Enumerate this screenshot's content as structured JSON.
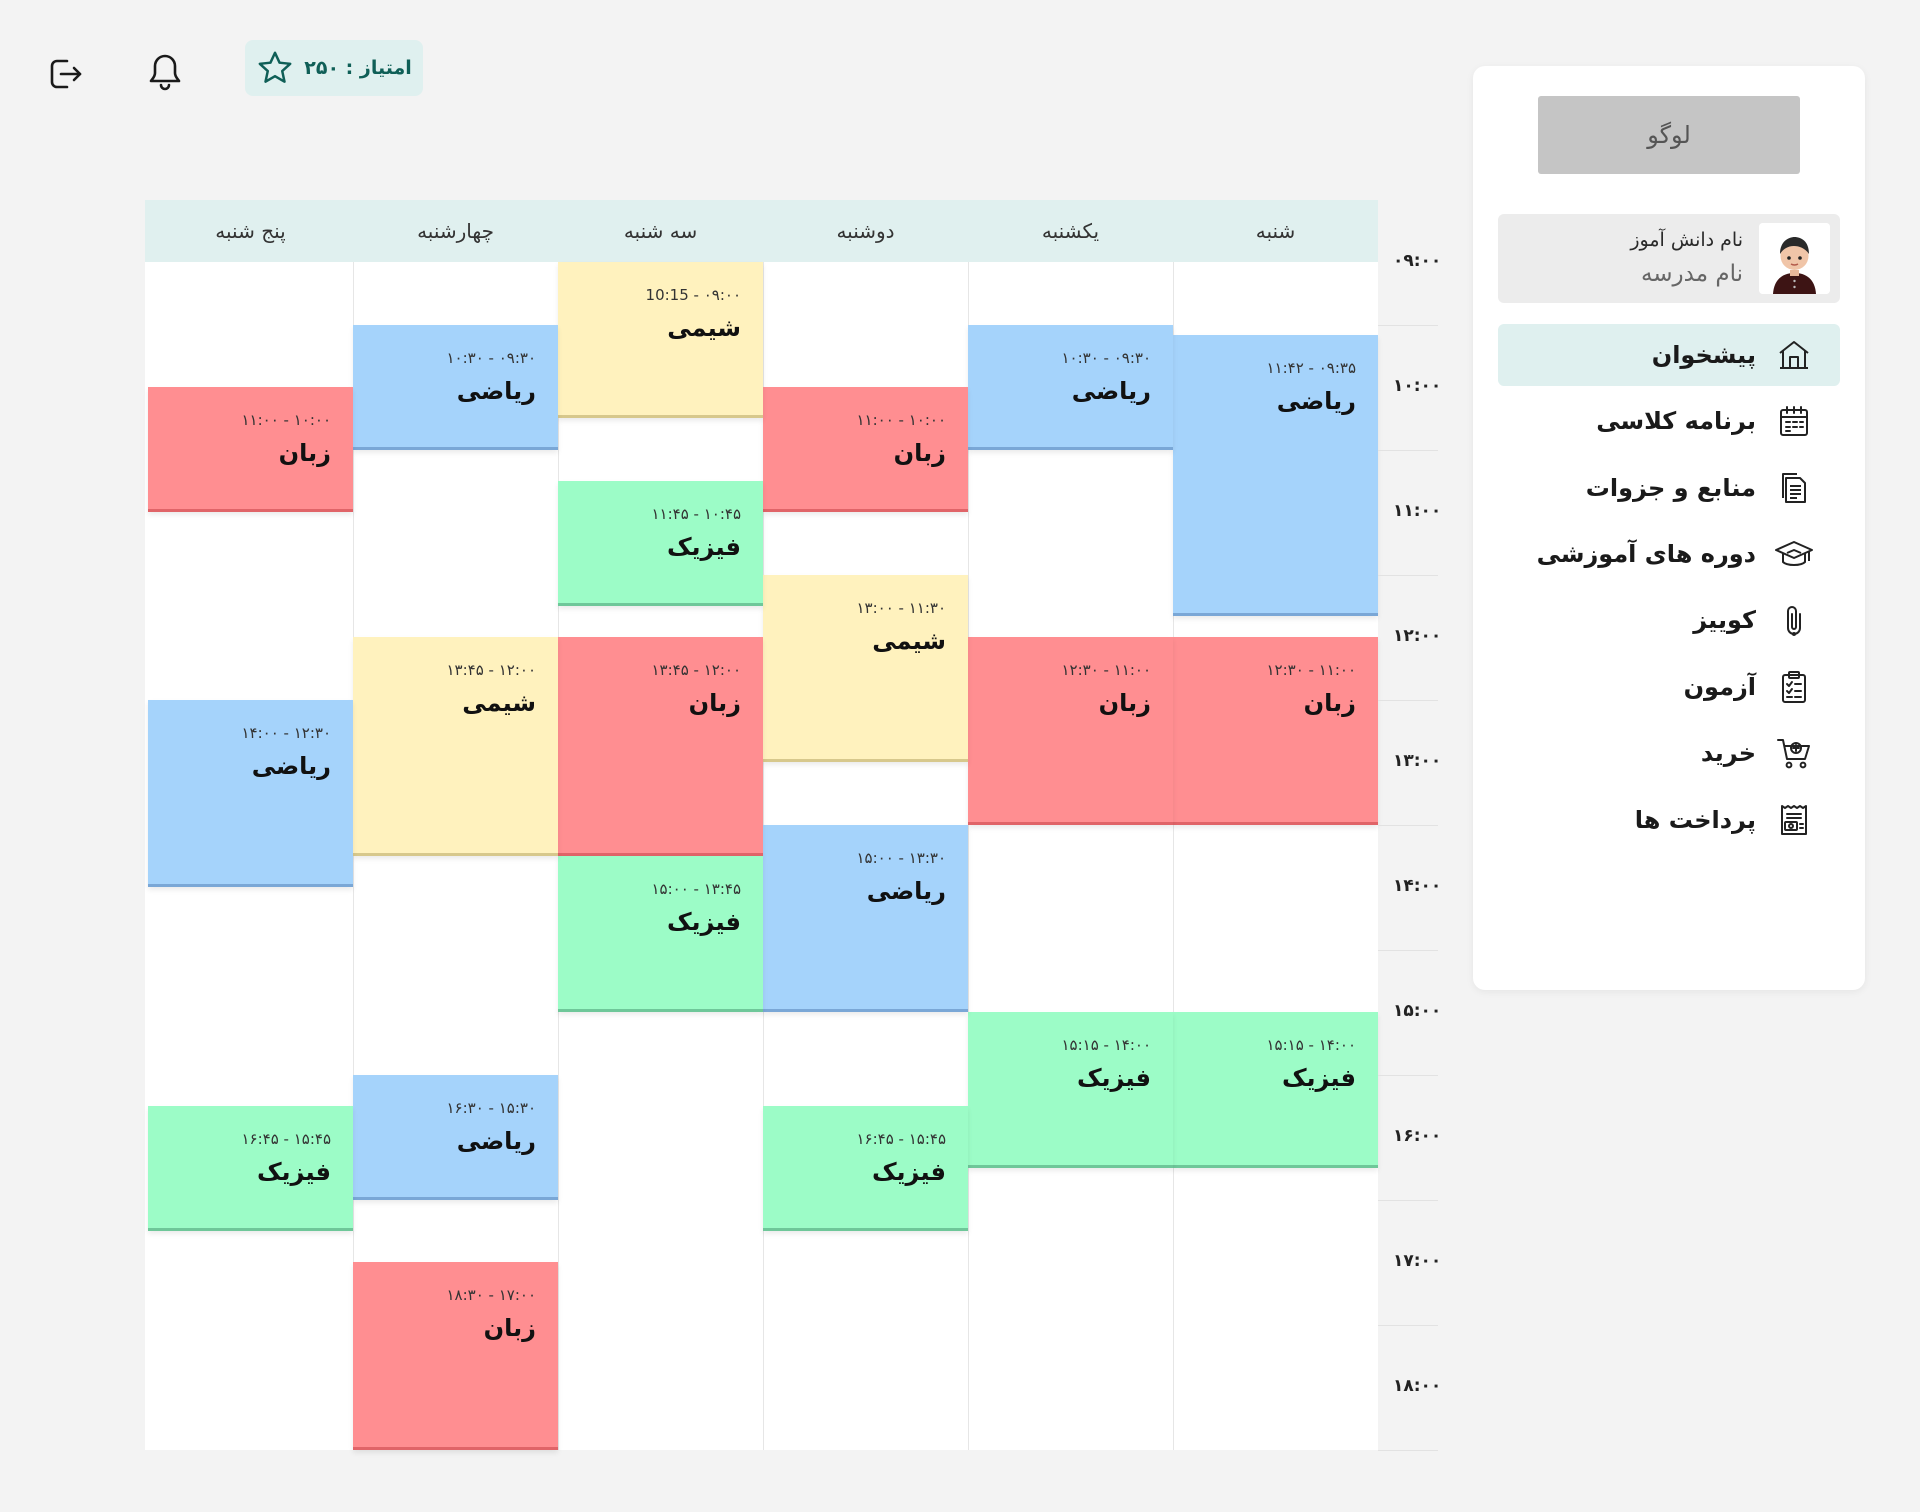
{
  "topbar": {
    "score_text": "امتیاز : ۲۵۰",
    "logout_icon": "logout-icon",
    "bell_icon": "bell-icon",
    "star_icon": "star-icon"
  },
  "sidebar": {
    "logo": "لوگو",
    "profile": {
      "student_name": "نام دانش آموز",
      "school_name": "نام مدرسه"
    },
    "items": [
      {
        "label": "پیشخوان",
        "icon": "home-icon",
        "active": true
      },
      {
        "label": "برنامه کلاسی",
        "icon": "calendar-icon",
        "active": false
      },
      {
        "label": "منابع و جزوات",
        "icon": "documents-icon",
        "active": false
      },
      {
        "label": "دوره های آموزشی",
        "icon": "graduation-cap-icon",
        "active": false
      },
      {
        "label": "کوییز",
        "icon": "paperclip-icon",
        "active": false
      },
      {
        "label": "آزمون",
        "icon": "clipboard-check-icon",
        "active": false
      },
      {
        "label": "خرید",
        "icon": "cart-icon",
        "active": false
      },
      {
        "label": "پرداخت ها",
        "icon": "receipt-icon",
        "active": false
      }
    ]
  },
  "schedule": {
    "days": [
      "شنبه",
      "یکشنبه",
      "دوشنبه",
      "سه شنبه",
      "چهارشنبه",
      "پنج شنبه"
    ],
    "times": [
      "۰۹:۰۰",
      "۱۰:۰۰",
      "۱۱:۰۰",
      "۱۲:۰۰",
      "۱۳:۰۰",
      "۱۴:۰۰",
      "۱۵:۰۰",
      "۱۶:۰۰",
      "۱۷:۰۰",
      "۱۸:۰۰"
    ],
    "colors": {
      "red": "#ff8e91",
      "blue": "#a5d3fb",
      "yellow": "#fff2be",
      "green": "#9cfcc7",
      "header": "#e0f0ef",
      "accent": "#0f5f57"
    },
    "classes": [
      {
        "day": 0,
        "name": "ریاضی",
        "time": "۰۹:۳۵ - ۱۱:۴۲",
        "start": 9.58,
        "end": 11.83,
        "color": "blue"
      },
      {
        "day": 0,
        "name": "زبان",
        "time": "۱۱:۰۰ - ۱۲:۳۰",
        "start": 12.0,
        "end": 13.5,
        "color": "red"
      },
      {
        "day": 0,
        "name": "فیزیک",
        "time": "۱۴:۰۰ - ۱۵:۱۵",
        "start": 15.0,
        "end": 16.25,
        "color": "green"
      },
      {
        "day": 1,
        "name": "ریاضی",
        "time": "۰۹:۳۰ - ۱۰:۳۰",
        "start": 9.5,
        "end": 10.5,
        "color": "blue"
      },
      {
        "day": 1,
        "name": "زبان",
        "time": "۱۱:۰۰ - ۱۲:۳۰",
        "start": 12.0,
        "end": 13.5,
        "color": "red"
      },
      {
        "day": 1,
        "name": "فیزیک",
        "time": "۱۴:۰۰ - ۱۵:۱۵",
        "start": 15.0,
        "end": 16.25,
        "color": "green"
      },
      {
        "day": 2,
        "name": "زبان",
        "time": "۱۰:۰۰ - ۱۱:۰۰",
        "start": 10.0,
        "end": 11.0,
        "color": "red"
      },
      {
        "day": 2,
        "name": "شیمی",
        "time": "۱۱:۳۰ - ۱۳:۰۰",
        "start": 11.5,
        "end": 13.0,
        "color": "yellow"
      },
      {
        "day": 2,
        "name": "ریاضی",
        "time": "۱۳:۳۰ - ۱۵:۰۰",
        "start": 13.5,
        "end": 15.0,
        "color": "blue"
      },
      {
        "day": 2,
        "name": "فیزیک",
        "time": "۱۵:۴۵ - ۱۶:۴۵",
        "start": 15.75,
        "end": 16.75,
        "color": "green"
      },
      {
        "day": 3,
        "name": "شیمی",
        "time": "۰۹:۰۰ - 10:15",
        "start": 9.0,
        "end": 10.25,
        "color": "yellow"
      },
      {
        "day": 3,
        "name": "فیزیک",
        "time": "۱۰:۴۵ - ۱۱:۴۵",
        "start": 10.75,
        "end": 11.75,
        "color": "green"
      },
      {
        "day": 3,
        "name": "زبان",
        "time": "۱۲:۰۰ - ۱۳:۴۵",
        "start": 12.0,
        "end": 13.75,
        "color": "red"
      },
      {
        "day": 3,
        "name": "فیزیک",
        "time": "۱۳:۴۵ - ۱۵:۰۰",
        "start": 13.75,
        "end": 15.0,
        "color": "green"
      },
      {
        "day": 4,
        "name": "ریاضی",
        "time": "۰۹:۳۰ - ۱۰:۳۰",
        "start": 9.5,
        "end": 10.5,
        "color": "blue"
      },
      {
        "day": 4,
        "name": "شیمی",
        "time": "۱۲:۰۰ - ۱۳:۴۵",
        "start": 12.0,
        "end": 13.75,
        "color": "yellow"
      },
      {
        "day": 4,
        "name": "ریاضی",
        "time": "۱۵:۳۰ - ۱۶:۳۰",
        "start": 15.5,
        "end": 16.5,
        "color": "blue"
      },
      {
        "day": 4,
        "name": "زبان",
        "time": "۱۷:۰۰ - ۱۸:۳۰",
        "start": 17.0,
        "end": 18.5,
        "color": "red"
      },
      {
        "day": 5,
        "name": "زبان",
        "time": "۱۰:۰۰ - ۱۱:۰۰",
        "start": 10.0,
        "end": 11.0,
        "color": "red"
      },
      {
        "day": 5,
        "name": "ریاضی",
        "time": "۱۲:۳۰ - ۱۴:۰۰",
        "start": 12.5,
        "end": 14.0,
        "color": "blue"
      },
      {
        "day": 5,
        "name": "فیزیک",
        "time": "۱۵:۴۵ - ۱۶:۴۵",
        "start": 15.75,
        "end": 16.75,
        "color": "green"
      }
    ]
  }
}
